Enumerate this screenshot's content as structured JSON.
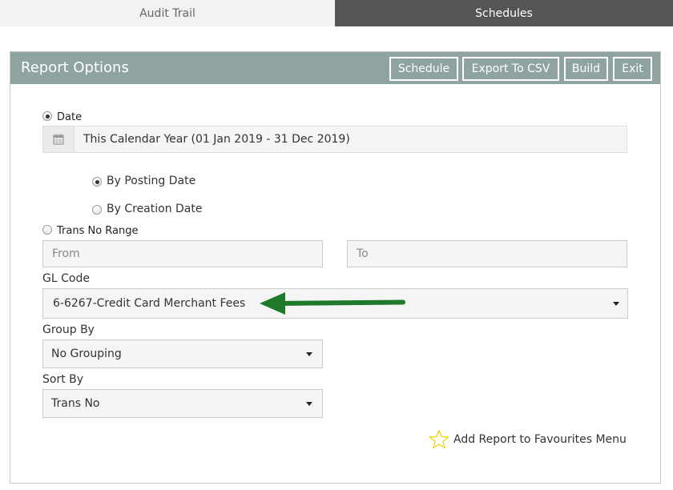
{
  "tabs": [
    {
      "label": "Audit Trail",
      "active": false
    },
    {
      "label": "Schedules",
      "active": true
    }
  ],
  "panel": {
    "title": "Report Options",
    "buttons": {
      "schedule": "Schedule",
      "export_csv": "Export To CSV",
      "build": "Build",
      "exit": "Exit"
    }
  },
  "date_option": {
    "label": "Date",
    "selected": true,
    "icon": "calendar-icon",
    "value": "This Calendar Year (01 Jan 2019 - 31 Dec 2019)",
    "sub_options": [
      {
        "label": "By Posting Date",
        "selected": true
      },
      {
        "label": "By Creation Date",
        "selected": false
      }
    ]
  },
  "trans_range": {
    "label": "Trans No Range",
    "selected": false,
    "from_placeholder": "From",
    "to_placeholder": "To"
  },
  "gl_code": {
    "label": "GL Code",
    "value": "6-6267-Credit Card Merchant Fees"
  },
  "group_by": {
    "label": "Group By",
    "value": "No Grouping"
  },
  "sort_by": {
    "label": "Sort By",
    "value": "Trans No"
  },
  "favourites": {
    "label": "Add Report to Favourites Menu",
    "icon": "star-outline-icon"
  },
  "colors": {
    "header": "#8fa3a1",
    "active_tab": "#555555",
    "arrow": "#1e7a2a",
    "star": "#f0d000"
  }
}
